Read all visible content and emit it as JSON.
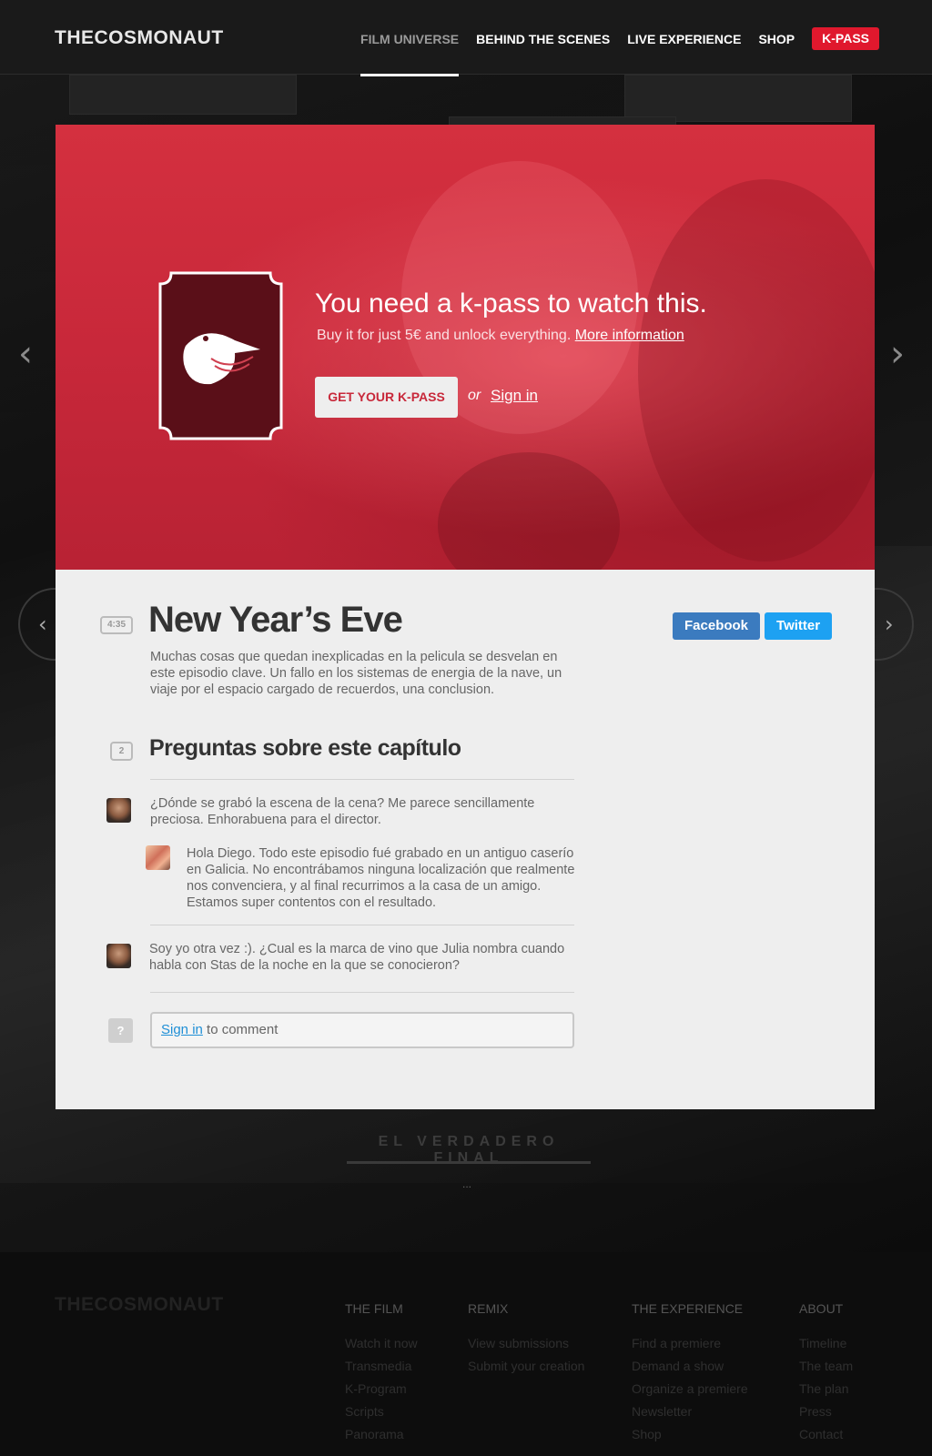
{
  "header": {
    "logo": "THECOSMONAUT",
    "nav": [
      {
        "label": "FILM UNIVERSE",
        "active": true
      },
      {
        "label": "BEHIND THE SCENES"
      },
      {
        "label": "LIVE EXPERIENCE"
      },
      {
        "label": "SHOP"
      },
      {
        "label": "K-PASS"
      }
    ]
  },
  "side_nav": {
    "prev_glyph": "‹",
    "next_glyph": "›"
  },
  "hero": {
    "title": "You need a k-pass to watch this.",
    "subtitle": "Buy it for just 5€ and unlock everything.",
    "more_info_link": "More information",
    "cta_button": "GET YOUR K-PASS",
    "or_text": "or",
    "signin_link": "Sign in"
  },
  "episode": {
    "duration": "4:35",
    "title": "New Year’s Eve",
    "description": "Muchas cosas que quedan inexplicadas en la pelicula se desvelan en este episodio clave. Un fallo en los sistemas de energia de la nave, un viaje por el espacio cargado de recuerdos, una conclusion.",
    "share": {
      "facebook": "Facebook",
      "twitter": "Twitter"
    }
  },
  "questions": {
    "count": "2",
    "title": "Preguntas sobre este capítulo",
    "items": [
      {
        "text": "¿Dónde se grabó la escena de la cena? Me parece sencillamente preciosa. Enhorabuena para el director.",
        "reply": "Hola Diego. Todo este episodio fué grabado en un antiguo caserío en Galicia. No encontrábamos ninguna localización que realmente nos convenciera, y al final recurrimos a la casa de un amigo. Estamos super contentos con el resultado."
      },
      {
        "text": "Soy yo otra vez :). ¿Cual es la marca de vino que Julia nombra cuando habla con Stas de la noche en la que se conocieron?"
      }
    ],
    "comment_icon": "?",
    "comment_signin": "Sign in",
    "comment_suffix": " to comment"
  },
  "section": {
    "title": "EL VERDADERO FINAL",
    "dots": "..."
  },
  "footer": {
    "logo": "THECOSMONAUT",
    "columns": [
      {
        "heading": "THE FILM",
        "links": [
          "Watch it now",
          "Transmedia",
          "K-Program",
          "Scripts",
          "Panorama"
        ]
      },
      {
        "heading": "REMIX",
        "links": [
          "View submissions",
          "Submit your creation"
        ]
      },
      {
        "heading": "THE EXPERIENCE",
        "links": [
          "Find a premiere",
          "Demand a show",
          "Organize a premiere",
          "Newsletter",
          "Shop"
        ]
      },
      {
        "heading": "ABOUT",
        "links": [
          "Timeline",
          "The team",
          "The plan",
          "Press",
          "Contact"
        ]
      }
    ]
  },
  "colors": {
    "accent": "#e0182d",
    "hero_red": "#c8283a",
    "facebook": "#3b7bbf",
    "twitter": "#1da1f2",
    "link": "#1f8fd6"
  }
}
